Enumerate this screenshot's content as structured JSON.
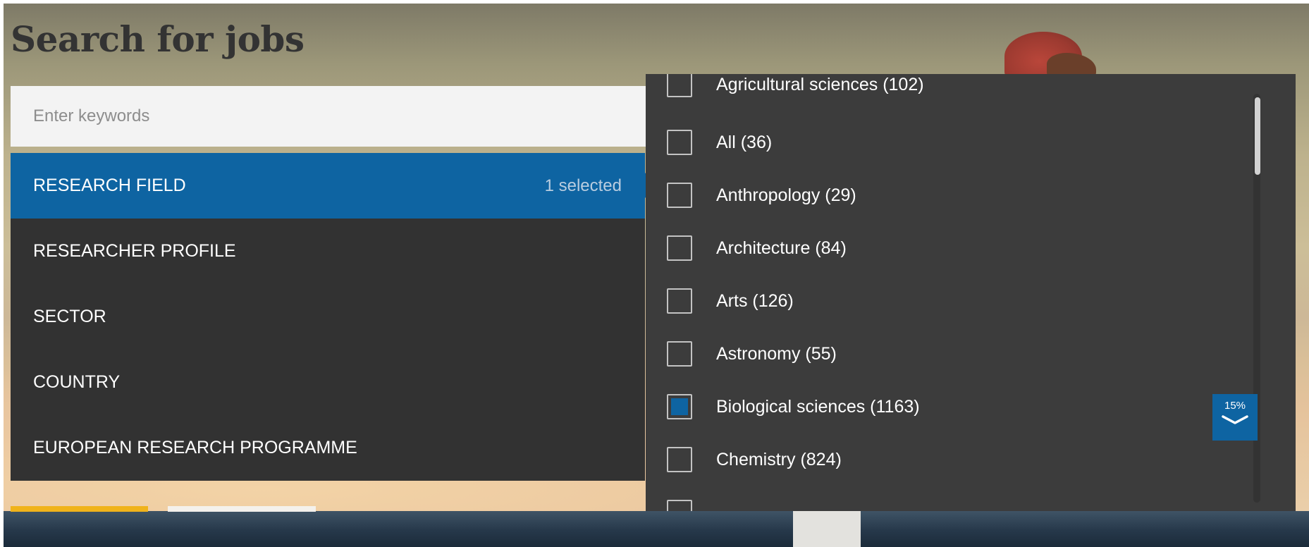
{
  "title": "Search for jobs",
  "search": {
    "placeholder": "Enter keywords",
    "value": ""
  },
  "filters": [
    {
      "label": "RESEARCH FIELD",
      "count": "1 selected",
      "active": true
    },
    {
      "label": "RESEARCHER PROFILE",
      "count": "",
      "active": false
    },
    {
      "label": "SECTOR",
      "count": "",
      "active": false
    },
    {
      "label": "COUNTRY",
      "count": "",
      "active": false
    },
    {
      "label": "EUROPEAN RESEARCH PROGRAMME",
      "count": "",
      "active": false
    }
  ],
  "options": [
    {
      "label": "Agricultural sciences (102)",
      "checked": false
    },
    {
      "label": "All (36)",
      "checked": false
    },
    {
      "label": "Anthropology (29)",
      "checked": false
    },
    {
      "label": "Architecture (84)",
      "checked": false
    },
    {
      "label": "Arts (126)",
      "checked": false
    },
    {
      "label": "Astronomy (55)",
      "checked": false
    },
    {
      "label": "Biological sciences (1163)",
      "checked": true
    },
    {
      "label": "Chemistry (824)",
      "checked": false
    }
  ],
  "scroll_progress": {
    "label": "15%",
    "value": 0.15
  },
  "colors": {
    "accent": "#0e64a2",
    "nav_bg": "#323232",
    "panel_bg": "#3c3c3c"
  },
  "icons": {
    "progress": "chevron-down-icon"
  }
}
